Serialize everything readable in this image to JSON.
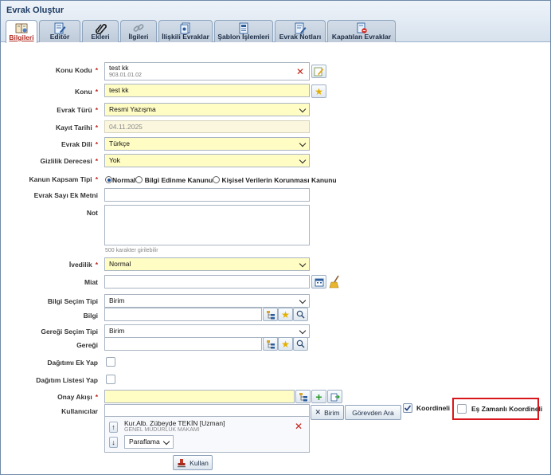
{
  "window": {
    "title": "Evrak Oluştur"
  },
  "tabs": [
    {
      "label": "Bilgileri",
      "icon": "document-book-icon"
    },
    {
      "label": "Editör",
      "icon": "edit-document-icon"
    },
    {
      "label": "Ekleri",
      "icon": "paperclip-icon"
    },
    {
      "label": "İlgileri",
      "icon": "link-icon"
    },
    {
      "label": "İlişkili Evraklar",
      "icon": "related-docs-icon"
    },
    {
      "label": "Şablon İşlemleri",
      "icon": "template-icon"
    },
    {
      "label": "Evrak Notları",
      "icon": "notes-icon"
    },
    {
      "label": "Kapatılan Evraklar",
      "icon": "closed-docs-icon"
    }
  ],
  "form": {
    "required_mark": "*",
    "konu_kodu": {
      "label": "Konu Kodu",
      "value": "test kk",
      "code": "903.01.01.02"
    },
    "konu": {
      "label": "Konu",
      "value": "test kk"
    },
    "evrak_turu": {
      "label": "Evrak Türü",
      "value": "Resmi Yazışma"
    },
    "kayit_tarihi": {
      "label": "Kayıt Tarihi",
      "value": "04.11.2025"
    },
    "evrak_dili": {
      "label": "Evrak Dili",
      "value": "Türkçe"
    },
    "gizlilik": {
      "label": "Gizlilik Derecesi",
      "value": "Yok"
    },
    "kanun_kapsam": {
      "label": "Kanun Kapsam Tipi",
      "options": [
        "Normal",
        "Bilgi Edinme Kanunu",
        "Kişisel Verilerin Korunması Kanunu"
      ],
      "selected": "Normal"
    },
    "evrak_sayi_ek": {
      "label": "Evrak Sayı Ek Metni",
      "value": ""
    },
    "not": {
      "label": "Not",
      "value": "",
      "hint": "500 karakter girilebilir"
    },
    "ivedilik": {
      "label": "İvedilik",
      "value": "Normal"
    },
    "miat": {
      "label": "Miat",
      "value": ""
    },
    "bilgi_secim_tipi": {
      "label": "Bilgi Seçim Tipi",
      "value": "Birim"
    },
    "bilgi": {
      "label": "Bilgi",
      "value": ""
    },
    "geregi_secim_tipi": {
      "label": "Gereği Seçim Tipi",
      "value": "Birim"
    },
    "geregi": {
      "label": "Gereği",
      "value": ""
    },
    "dagitimi_ek_yap": {
      "label": "Dağıtımı Ek Yap",
      "checked": false
    },
    "dagitim_listesi_yap": {
      "label": "Dağıtım Listesi Yap",
      "checked": false
    },
    "onay_akisi": {
      "label": "Onay Akışı",
      "value": ""
    },
    "kullanicilar": {
      "label": "Kullanıcılar",
      "value": "",
      "birim_button": "Birim",
      "gorevden_ara_button": "Görevden Ara",
      "koordineli_label": "Koordineli",
      "koordineli_checked": true,
      "es_zamanli_label": "Eş Zamanlı Koordineli",
      "es_zamanli_checked": false
    },
    "selected_user": {
      "name": "Kur.Alb. Zübeyde TEKİN [Uzman]",
      "unit": "GENEL MÜDÜRLÜK MAKAMI",
      "action": "Paraflama"
    },
    "kullan_button": "Kullan"
  },
  "colors": {
    "required_field_bg": "#fffcc4",
    "highlight_border": "#d9161c",
    "active_tab_text": "#b0281f"
  }
}
